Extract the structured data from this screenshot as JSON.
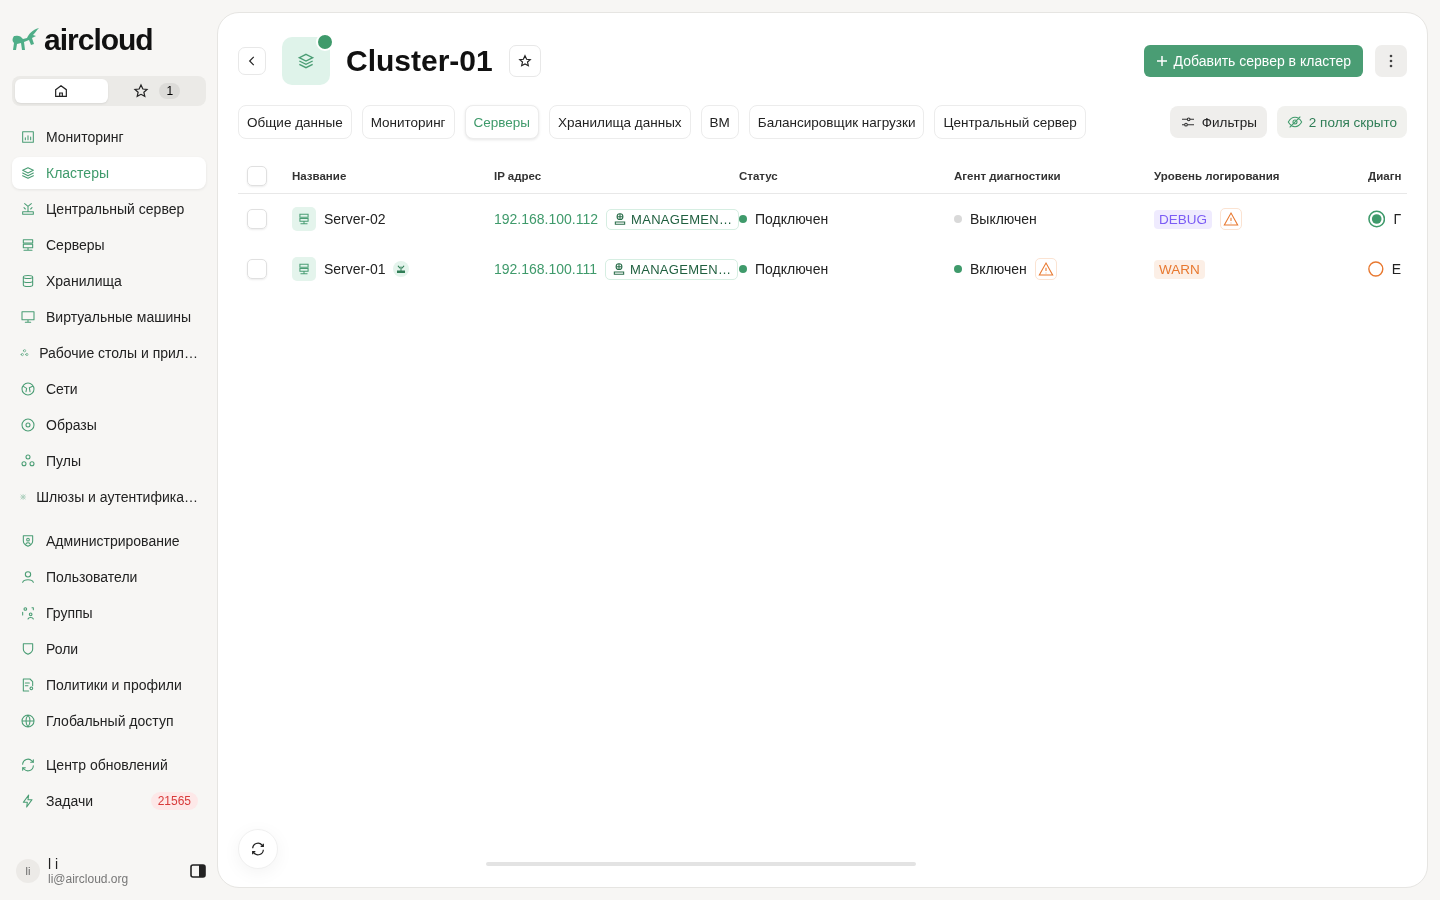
{
  "sidebar": {
    "logo": "aircloud",
    "switcher": [
      {
        "kind": "home",
        "selected": true
      },
      {
        "kind": "favorites",
        "count": "1",
        "selected": false
      }
    ],
    "sections": [
      [
        {
          "label": "Мониторинг",
          "selected": false
        },
        {
          "label": "Кластеры",
          "selected": true
        },
        {
          "label": "Центральный сервер",
          "selected": false
        },
        {
          "label": "Серверы",
          "selected": false
        },
        {
          "label": "Хранилища",
          "selected": false
        },
        {
          "label": "Виртуальные машины",
          "selected": false
        },
        {
          "label": "Рабочие столы и прил…",
          "selected": false
        },
        {
          "label": "Сети",
          "selected": false
        },
        {
          "label": "Образы",
          "selected": false
        },
        {
          "label": "Пулы",
          "selected": false
        },
        {
          "label": "Шлюзы и аутентифика…",
          "selected": false
        }
      ],
      [
        {
          "label": "Администрирование",
          "selected": false
        },
        {
          "label": "Пользователи",
          "selected": false
        },
        {
          "label": "Группы",
          "selected": false
        },
        {
          "label": "Роли",
          "selected": false
        },
        {
          "label": "Политики и профили",
          "selected": false
        },
        {
          "label": "Глобальный доступ",
          "selected": false
        }
      ],
      [
        {
          "label": "Центр обновлений",
          "selected": false
        },
        {
          "label": "Задачи",
          "badge": "21565",
          "selected": false
        }
      ]
    ],
    "user": {
      "initials": "li",
      "name": "l i",
      "email": "li@aircloud.org"
    }
  },
  "header": {
    "title": "Cluster-01",
    "online": true,
    "primary_button": "Добавить сервер в кластер"
  },
  "tabs": [
    {
      "label": "Общие данные",
      "selected": false
    },
    {
      "label": "Мониторинг",
      "selected": false
    },
    {
      "label": "Серверы",
      "selected": true
    },
    {
      "label": "Хранилища данных",
      "selected": false
    },
    {
      "label": "ВМ",
      "selected": false
    },
    {
      "label": "Балансировщик нагрузки",
      "selected": false
    },
    {
      "label": "Центральный сервер",
      "selected": false
    }
  ],
  "filters_button": "Фильтры",
  "hidden_fields_button": "2 поля скрыто",
  "table": {
    "all_checked": false,
    "columns": [
      "Название",
      "IP адрес",
      "Статус",
      "Агент диагностики",
      "Уровень логирования",
      "Диагн"
    ],
    "rows": [
      {
        "checked": false,
        "name": "Server-02",
        "central": false,
        "ip": "192.168.100.112",
        "network": "MANAGEMEN…",
        "status": {
          "text": "Подключен",
          "color": "#3f9a6b"
        },
        "agent": {
          "text": "Выключен",
          "color": "#d9d9d9",
          "warning": false
        },
        "log": {
          "text": "DEBUG",
          "color": "#7b5cf5",
          "warning": true
        },
        "diag": {
          "kind": "ok",
          "text": "Г"
        }
      },
      {
        "checked": false,
        "name": "Server-01",
        "central": true,
        "ip": "192.168.100.111",
        "network": "MANAGEMEN…",
        "status": {
          "text": "Подключен",
          "color": "#3f9a6b"
        },
        "agent": {
          "text": "Включен",
          "color": "#3f9a6b",
          "warning": true
        },
        "log": {
          "text": "WARN",
          "color": "#e8782f",
          "warning": false
        },
        "diag": {
          "kind": "warn",
          "text": "Е"
        }
      }
    ]
  }
}
